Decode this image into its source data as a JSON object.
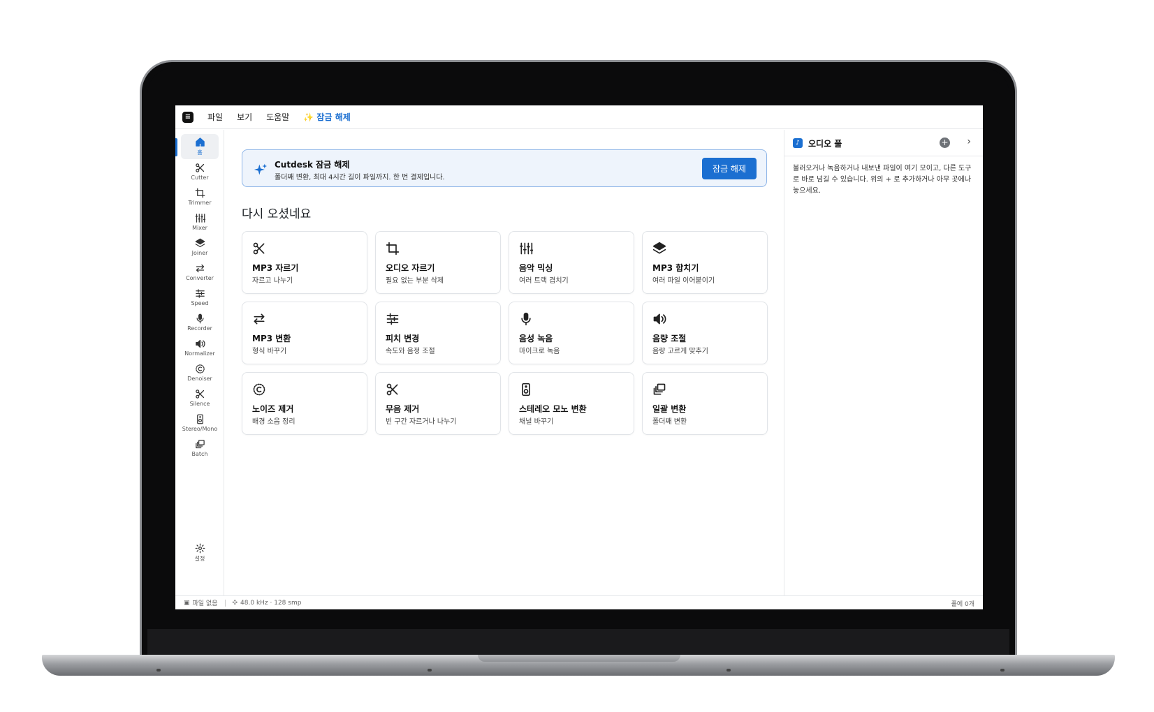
{
  "menu": {
    "logo": "≡",
    "items": [
      "파일",
      "보기",
      "도움말"
    ],
    "unlock": "✨ 잠금 해제"
  },
  "sidebar": {
    "items": [
      {
        "label": "홈",
        "icon": "home-icon"
      },
      {
        "label": "Cutter",
        "icon": "scissors-icon"
      },
      {
        "label": "Trimmer",
        "icon": "crop-icon"
      },
      {
        "label": "Mixer",
        "icon": "mixer-icon"
      },
      {
        "label": "Joiner",
        "icon": "layers-icon"
      },
      {
        "label": "Converter",
        "icon": "swap-icon"
      },
      {
        "label": "Speed",
        "icon": "sliders-icon"
      },
      {
        "label": "Recorder",
        "icon": "mic-icon"
      },
      {
        "label": "Normalizer",
        "icon": "speaker-icon"
      },
      {
        "label": "Denoiser",
        "icon": "denoise-icon"
      },
      {
        "label": "Silence",
        "icon": "scissors-icon"
      },
      {
        "label": "Stereo/Mono",
        "icon": "stereo-icon"
      },
      {
        "label": "Batch",
        "icon": "batch-icon"
      }
    ],
    "settings": "설정"
  },
  "banner": {
    "title": "Cutdesk 잠금 해제",
    "subtitle": "폴더째 변환, 최대 4시간 길이 파일까지. 한 번 결제입니다.",
    "button": "잠금 해제"
  },
  "welcome": "다시 오셨네요",
  "cards": [
    {
      "title": "MP3 자르기",
      "subtitle": "자르고 나누기",
      "icon": "scissors-icon"
    },
    {
      "title": "오디오 자르기",
      "subtitle": "필요 없는 부분 삭제",
      "icon": "crop-icon"
    },
    {
      "title": "음악 믹싱",
      "subtitle": "여러 트랙 겹치기",
      "icon": "mixer-icon"
    },
    {
      "title": "MP3 합치기",
      "subtitle": "여러 파일 이어붙이기",
      "icon": "layers-icon"
    },
    {
      "title": "MP3 변환",
      "subtitle": "형식 바꾸기",
      "icon": "swap-icon"
    },
    {
      "title": "피치 변경",
      "subtitle": "속도와 음정 조절",
      "icon": "sliders-icon"
    },
    {
      "title": "음성 녹음",
      "subtitle": "마이크로 녹음",
      "icon": "mic-icon"
    },
    {
      "title": "음량 조절",
      "subtitle": "음량 고르게 맞추기",
      "icon": "speaker-icon"
    },
    {
      "title": "노이즈 제거",
      "subtitle": "배경 소음 정리",
      "icon": "denoise-icon"
    },
    {
      "title": "무음 제거",
      "subtitle": "빈 구간 자르거나 나누기",
      "icon": "scissors-icon"
    },
    {
      "title": "스테레오 모노 변환",
      "subtitle": "채널 바꾸기",
      "icon": "stereo-icon"
    },
    {
      "title": "일괄 변환",
      "subtitle": "폴더째 변환",
      "icon": "batch-icon"
    }
  ],
  "pool": {
    "title": "오디오 풀",
    "description": "불러오거나 녹음하거나 내보낸 파일이 여기 모이고, 다른 도구로 바로 넘길 수 있습니다. 위의 + 로 추가하거나 아무 곳에나 놓으세요.",
    "add": "+",
    "next": "›"
  },
  "status": {
    "file": "파일 없음",
    "audio": "48.0 kHz · 128 smp",
    "pool_count": "풀에 0개"
  },
  "colors": {
    "accent": "#1b6fd1"
  }
}
